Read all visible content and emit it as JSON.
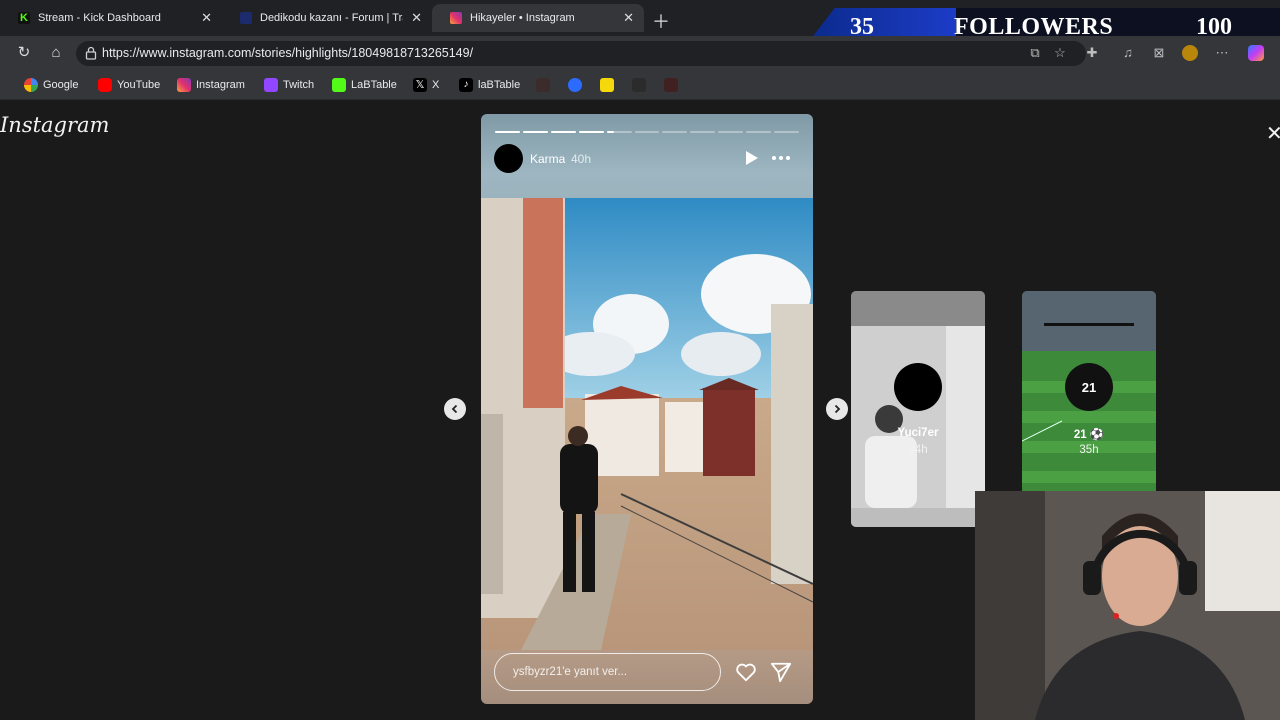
{
  "browser": {
    "tabs": [
      {
        "title": "Stream - Kick Dashboard",
        "icon": "kick-icon",
        "active": false
      },
      {
        "title": "Dedikodu kazanı - Forum | Transfe",
        "icon": "forum-icon",
        "active": false
      },
      {
        "title": "Hikayeler • Instagram",
        "icon": "instagram-icon",
        "active": true
      }
    ],
    "url": "https://www.instagram.com/stories/highlights/18049818713265149/",
    "bookmarks": [
      {
        "label": "Google",
        "icon": "google-icon"
      },
      {
        "label": "YouTube",
        "icon": "youtube-icon"
      },
      {
        "label": "Instagram",
        "icon": "instagram-icon"
      },
      {
        "label": "Twitch",
        "icon": "twitch-icon"
      },
      {
        "label": "LaBTable",
        "icon": "kick-icon"
      },
      {
        "label": "X",
        "icon": "x-icon"
      },
      {
        "label": "laBTable",
        "icon": "tiktok-icon"
      }
    ]
  },
  "overlay": {
    "followers_current": "35",
    "followers_label": "FOLLOWERS",
    "followers_goal": "100"
  },
  "instagram": {
    "logo": "Instagram",
    "story": {
      "username": "Karma",
      "time": "40h",
      "segments_total": 11,
      "segments_completed": 4,
      "current_segment_progress": 0.3,
      "reply_placeholder": "ysfbyzr21'e yanıt ver..."
    },
    "previews": [
      {
        "username": "Yuci7er",
        "time": "94h"
      },
      {
        "username": "21 ⚽",
        "time": "35h",
        "avatar_text": "21"
      }
    ]
  },
  "colors": {
    "page_bg": "#1a1a1a",
    "tab_bar": "#202124",
    "toolbar": "#35363a",
    "overlay_blue": "#1d3dcc"
  }
}
